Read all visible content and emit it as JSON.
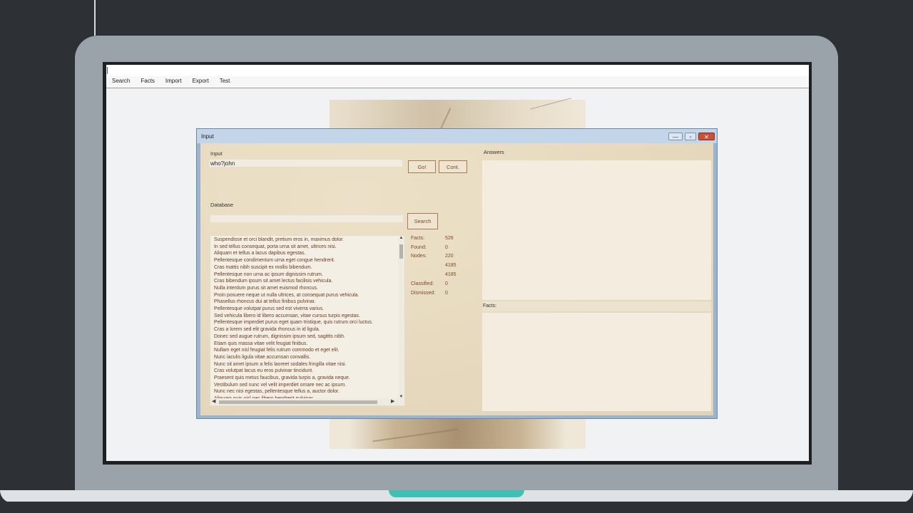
{
  "menu": [
    "Search",
    "Facts",
    "Import",
    "Export",
    "Test"
  ],
  "dialog": {
    "title": "Input",
    "window_buttons": {
      "minimize": "—",
      "maximize": "▫",
      "close": "✕"
    }
  },
  "input": {
    "label": "Input",
    "value": "who?john",
    "go_label": "Go!",
    "cont_label": "Cont."
  },
  "database": {
    "label": "Database",
    "search_value": "",
    "search_label": "Search",
    "lines": [
      "Suspendisse et orci blandit, pretium eros in, maximus dolor.",
      "In sed tellus consequat, porta urna sit amet, ultrices nisi.",
      "Aliquam et tellus a lacus dapibus egestas.",
      "Pellentesque condimentum urna eget congue hendrerit.",
      "Cras mattis nibh suscipit ex mollis bibendum.",
      "Pellentesque non urna ac ipsum dignissim rutrum.",
      "Cras bibendum ipsum sit amet lectus facilisis vehicula.",
      "Nulla interdum purus sit amet euismod rhoncus.",
      "Proin posuere neque ut nulla ultrices, at consequat purus vehicula.",
      "Phasellus rhoncus dui at tellus finibus pulvinar.",
      "Pellentesque volutpat purus sed est viverra varius.",
      "Sed vehicula libero id libero accumsan, vitae cursus turpis egestas.",
      "Pellentesque imperdiet purus eget quam tristique, quis rutrum orci luctus.",
      "Cras a lorem sed elit gravida rhoncus in id ligula.",
      "Donec sed augue rutrum, dignissim ipsum sed, sagittis nibh.",
      "Etiam quis massa vitae velit feugiat finibus.",
      "Nullam eget nisl feugiat felis rutrum commodo et eget elit.",
      "Nunc iaculis ligula vitae accumsan convallis.",
      "Nunc sit amet ipsum a felis laoreet sodales fringilla vitae nisi.",
      "Cras volutpat lacus eu eros pulvinar tincidunt.",
      "Praesent quis metus faucibus, gravida turpis a, gravida neque.",
      "Vestibulum sed nunc vel velit imperdiet ornare nec ac ipsum.",
      "Nunc nec nisi egestas, pellentesque tellus a, auctor dolor.",
      "Aliquam quis nisl nec libero hendrerit pulvinar."
    ]
  },
  "stats": {
    "facts_label": "Facts:",
    "facts_value": "526",
    "found_label": "Found:",
    "found_value": "0",
    "nodes_label": "Nodes:",
    "nodes_value": "220",
    "extra1_value": "4185",
    "extra2_value": "4185",
    "classified_label": "Classified:",
    "classified_value": "0",
    "dismissed_label": "Dismissed:",
    "dismissed_value": "0"
  },
  "answers": {
    "label": "Answers"
  },
  "facts_panel": {
    "label": "Facts:"
  },
  "colors": {
    "parchment": "#e7dabf",
    "text_brown": "#7b4a28",
    "list_text": "#6d3a1e",
    "dialog_frame": "#9bb4cf",
    "laptop_body": "#9aa2aa",
    "accent_teal": "#3fc0b4"
  }
}
